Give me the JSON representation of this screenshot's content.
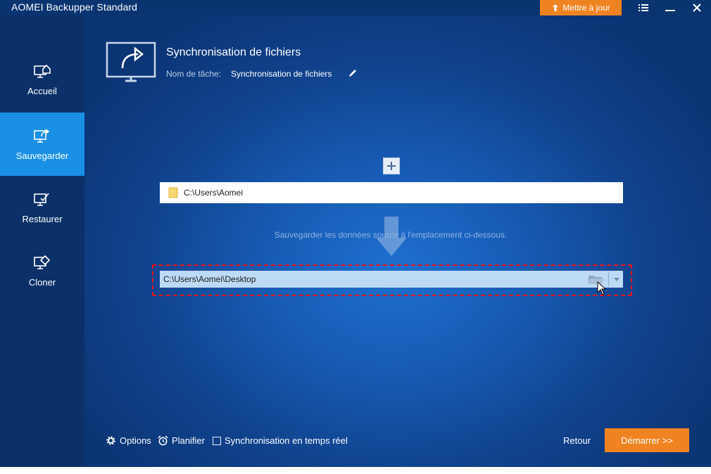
{
  "window": {
    "title": "AOMEI Backupper Standard"
  },
  "titlebar": {
    "update_label": "Mettre à jour",
    "menu_icon": "menu-icon",
    "minimize_icon": "minimize-icon",
    "close_icon": "close-icon"
  },
  "sidebar": {
    "items": [
      {
        "label": "Accueil",
        "icon": "home-icon",
        "active": false
      },
      {
        "label": "Sauvegarder",
        "icon": "backup-icon",
        "active": true
      },
      {
        "label": "Restaurer",
        "icon": "restore-icon",
        "active": false
      },
      {
        "label": "Cloner",
        "icon": "clone-icon",
        "active": false
      }
    ]
  },
  "task": {
    "title": "Synchronisation de fichiers",
    "name_label": "Nom de tâche:",
    "name_value": "Synchronisation de fichiers"
  },
  "source": {
    "path": "C:\\Users\\Aomei"
  },
  "hint": "Sauvegarder les données source à l'emplacement ci-dessous.",
  "destination": {
    "path": "C:\\Users\\Aomei\\Desktop"
  },
  "bottom": {
    "options_label": "Options",
    "schedule_label": "Planifier",
    "realtime_label": "Synchronisation en temps réel",
    "realtime_checked": false,
    "back_label": "Retour",
    "start_label": "Démarrer >>"
  },
  "colors": {
    "accent": "#f08321",
    "active_nav": "#1a8fe6",
    "highlight_border": "#e0161b"
  }
}
